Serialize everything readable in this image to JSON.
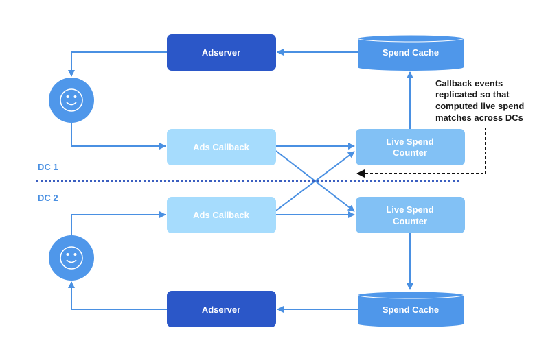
{
  "colors": {
    "adserver": "#2b57c8",
    "spend_cache": "#4f97ea",
    "ads_callback": "#a6dcfd",
    "live_spend_counter": "#82c1f5",
    "user": "#4f97ea",
    "edge": "#4a90e2",
    "dc_divider": "#3b5fc0",
    "replication": "#111111"
  },
  "dc1": {
    "label": "DC 1",
    "adserver": "Adserver",
    "spend_cache": "Spend Cache",
    "ads_callback": "Ads Callback",
    "live_spend_counter": [
      "Live Spend",
      "Counter"
    ],
    "user_icon": "smiley-icon"
  },
  "dc2": {
    "label": "DC 2",
    "adserver": "Adserver",
    "spend_cache": "Spend Cache",
    "ads_callback": "Ads Callback",
    "live_spend_counter": [
      "Live Spend",
      "Counter"
    ],
    "user_icon": "smiley-icon"
  },
  "annotation": [
    "Callback events",
    "replicated so that",
    "computed live spend",
    "matches across DCs"
  ]
}
